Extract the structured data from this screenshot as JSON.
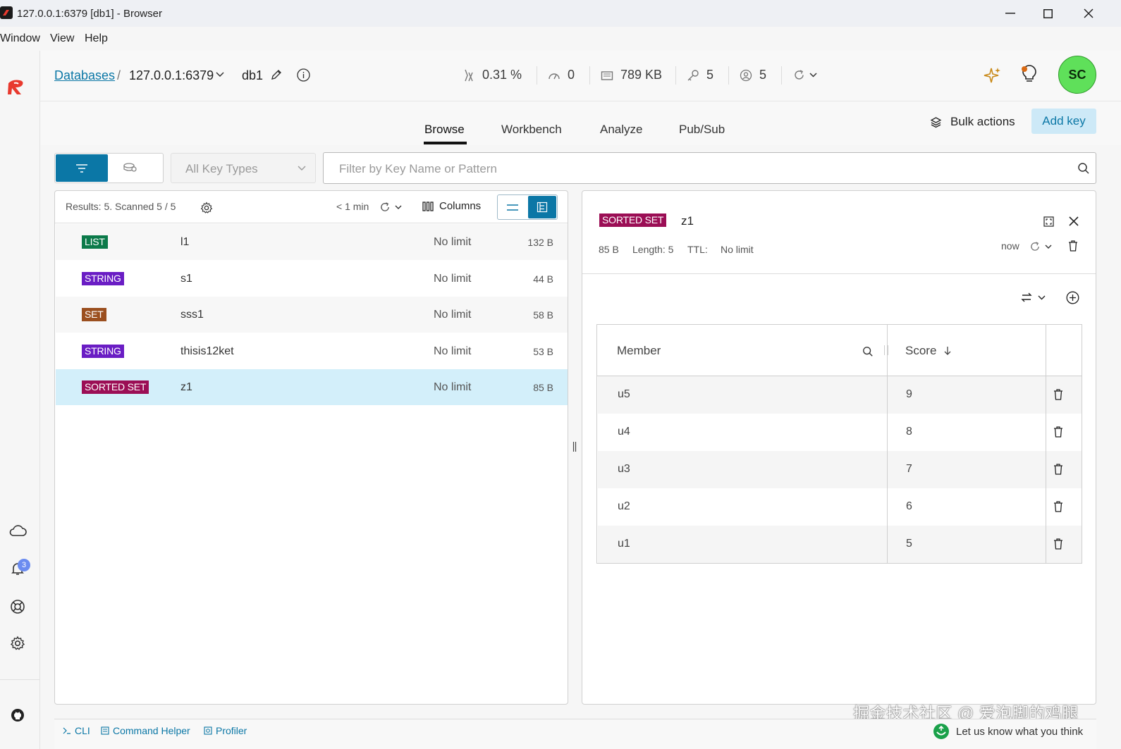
{
  "window": {
    "title": "127.0.0.1:6379 [db1] - Browser"
  },
  "menu": [
    "Window",
    "View",
    "Help"
  ],
  "header": {
    "breadcrumb_root": "Databases",
    "breadcrumb_sep": "/",
    "connection": "127.0.0.1:6379",
    "db_name": "db1",
    "metrics": {
      "cpu": "0.31 %",
      "ops": "0",
      "memory": "789 KB",
      "keys": "5",
      "clients": "5"
    },
    "avatar_initials": "SC"
  },
  "tabs": [
    "Browse",
    "Workbench",
    "Analyze",
    "Pub/Sub"
  ],
  "active_tab": "Browse",
  "actions": {
    "bulk_actions": "Bulk actions",
    "add_key": "Add key"
  },
  "filter": {
    "key_type": "All Key Types",
    "search_placeholder": "Filter by Key Name or Pattern"
  },
  "key_list": {
    "results": "Results: 5. Scanned 5 / 5",
    "refresh_age": "< 1 min",
    "columns_label": "Columns",
    "rows": [
      {
        "type": "LIST",
        "name": "l1",
        "ttl": "No limit",
        "size": "132 B",
        "color": "#0c7a4a"
      },
      {
        "type": "STRING",
        "name": "s1",
        "ttl": "No limit",
        "size": "44 B",
        "color": "#6a1dc4"
      },
      {
        "type": "SET",
        "name": "sss1",
        "ttl": "No limit",
        "size": "58 B",
        "color": "#9b4f1f"
      },
      {
        "type": "STRING",
        "name": "thisis12ket",
        "ttl": "No limit",
        "size": "53 B",
        "color": "#6a1dc4"
      },
      {
        "type": "SORTED SET",
        "name": "z1",
        "ttl": "No limit",
        "size": "85 B",
        "color": "#9b0e55"
      }
    ],
    "selected_index": 4
  },
  "details": {
    "type": "SORTED SET",
    "type_color": "#9b0e55",
    "name": "z1",
    "size": "85 B",
    "length": "Length: 5",
    "ttl_label": "TTL:",
    "ttl_value": "No limit",
    "refreshed": "now",
    "columns": {
      "member": "Member",
      "score": "Score"
    },
    "rows": [
      {
        "member": "u5",
        "score": "9"
      },
      {
        "member": "u4",
        "score": "8"
      },
      {
        "member": "u3",
        "score": "7"
      },
      {
        "member": "u2",
        "score": "6"
      },
      {
        "member": "u1",
        "score": "5"
      }
    ]
  },
  "footer": {
    "cli": "CLI",
    "command_helper": "Command Helper",
    "profiler": "Profiler",
    "feedback": "Let us know what you think",
    "watermark": "掘金技术社区 @ 爱泡脚的鸡腿"
  },
  "notifications_count": "3",
  "colors": {
    "accent": "#0b77a6",
    "selected_row": "#d3effa",
    "add_key_bg": "#cde9f7",
    "avatar_bg": "#5fe05a"
  }
}
